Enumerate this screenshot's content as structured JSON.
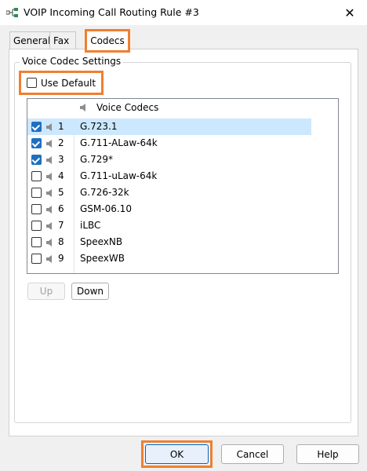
{
  "window": {
    "title": "VOIP Incoming Call Routing Rule #3",
    "close_glyph": "✕"
  },
  "tabs": [
    {
      "label": "General"
    },
    {
      "label": "Fax"
    },
    {
      "label": "Codecs",
      "active": true
    }
  ],
  "group": {
    "title": "Voice Codec Settings",
    "use_default_label": "Use Default",
    "use_default_checked": false
  },
  "list": {
    "header_label": "Voice Codecs",
    "rows": [
      {
        "num": "1",
        "codec": "G.723.1",
        "checked": true,
        "selected": true
      },
      {
        "num": "2",
        "codec": "G.711-ALaw-64k",
        "checked": true,
        "selected": false
      },
      {
        "num": "3",
        "codec": "G.729*",
        "checked": true,
        "selected": false
      },
      {
        "num": "4",
        "codec": "G.711-uLaw-64k",
        "checked": false,
        "selected": false
      },
      {
        "num": "5",
        "codec": "G.726-32k",
        "checked": false,
        "selected": false
      },
      {
        "num": "6",
        "codec": "GSM-06.10",
        "checked": false,
        "selected": false
      },
      {
        "num": "7",
        "codec": "iLBC",
        "checked": false,
        "selected": false
      },
      {
        "num": "8",
        "codec": "SpeexNB",
        "checked": false,
        "selected": false
      },
      {
        "num": "9",
        "codec": "SpeexWB",
        "checked": false,
        "selected": false
      }
    ]
  },
  "buttons": {
    "up": "Up",
    "down": "Down",
    "ok": "OK",
    "cancel": "Cancel",
    "help": "Help"
  },
  "colors": {
    "highlight_outline": "#f07f30",
    "selection": "#cce8ff",
    "checkbox_checked": "#1f6fc0"
  }
}
